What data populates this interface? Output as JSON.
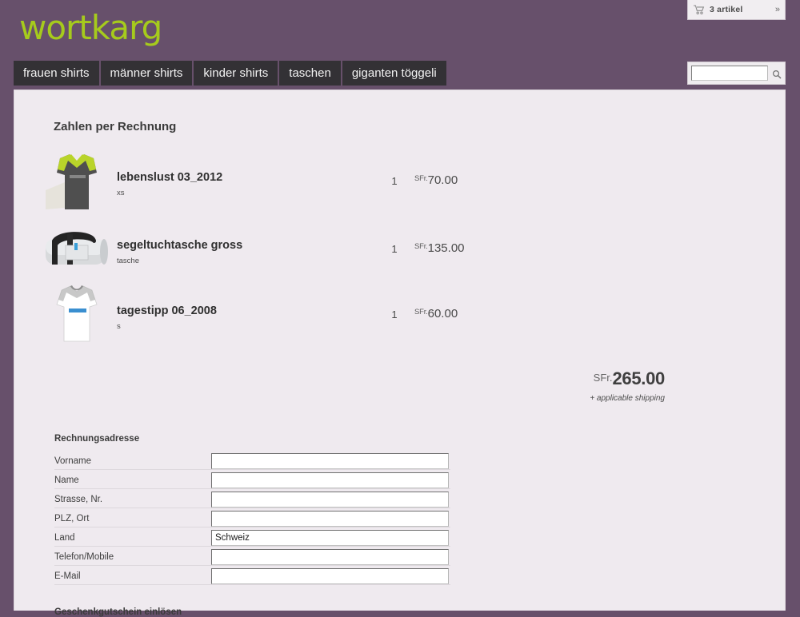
{
  "header": {
    "logo_text": "wortkarg",
    "cart": {
      "icon": "shopping-cart-icon",
      "count_label": "3 artikel",
      "expand_label": "»"
    },
    "search": {
      "value": "",
      "placeholder": "",
      "icon": "magnifier-icon"
    },
    "nav_items": [
      {
        "label": "frauen shirts"
      },
      {
        "label": "männer shirts"
      },
      {
        "label": "kinder shirts"
      },
      {
        "label": "taschen"
      },
      {
        "label": "giganten töggeli"
      }
    ]
  },
  "main": {
    "page_title": "Zahlen per Rechnung",
    "items": [
      {
        "name": "lebenslust 03_2012",
        "variant": "xs",
        "quantity": "1",
        "currency": "SFr.",
        "price": "70.00",
        "thumb": "grey-vneck-tshirt-thumbnail"
      },
      {
        "name": "segeltuchtasche gross",
        "variant": "tasche",
        "quantity": "1",
        "currency": "SFr.",
        "price": "135.00",
        "thumb": "canvas-duffel-bag-thumbnail"
      },
      {
        "name": "tagestipp 06_2008",
        "variant": "s",
        "quantity": "1",
        "currency": "SFr.",
        "price": "60.00",
        "thumb": "white-tshirt-thumbnail"
      }
    ],
    "total": {
      "currency": "SFr.",
      "amount": "265.00",
      "note": "+ applicable shipping"
    },
    "billing_form": {
      "legend": "Rechnungsadresse",
      "fields": [
        {
          "label": "Vorname",
          "value": ""
        },
        {
          "label": "Name",
          "value": ""
        },
        {
          "label": "Strasse, Nr.",
          "value": ""
        },
        {
          "label": "PLZ, Ort",
          "value": ""
        },
        {
          "label": "Land",
          "value": "Schweiz"
        },
        {
          "label": "Telefon/Mobile",
          "value": ""
        },
        {
          "label": "E-Mail",
          "value": ""
        }
      ]
    },
    "voucher_heading": "Geschenkgutschein einlösen"
  },
  "colors": {
    "page_background": "#67506b",
    "panel_background": "#efeaef",
    "logo_green": "#a6cb1c",
    "nav_background": "#333135"
  }
}
